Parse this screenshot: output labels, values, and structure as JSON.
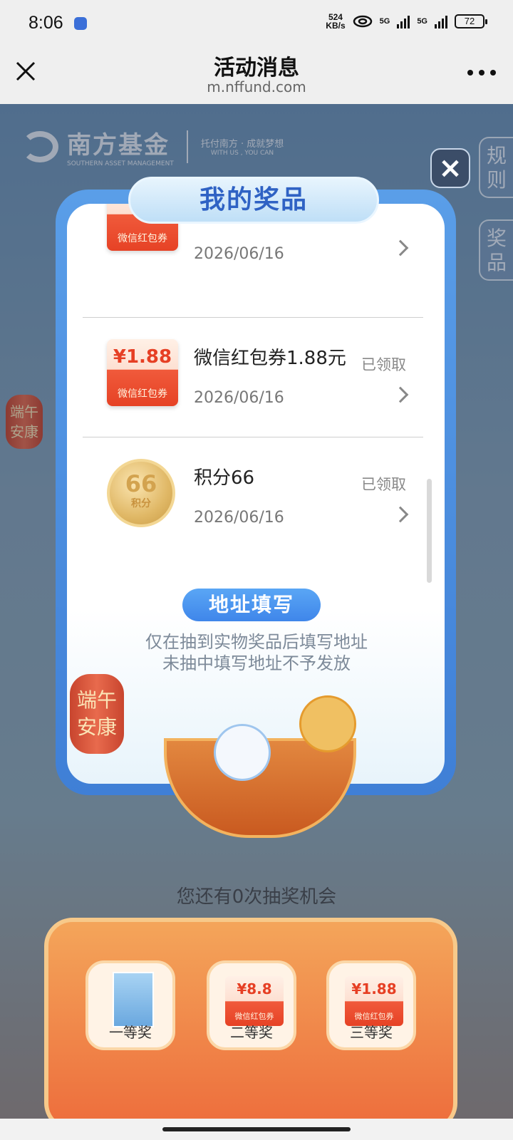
{
  "status": {
    "time": "8:06",
    "speed_num": "524",
    "speed_unit": "KB/s",
    "net1": "5G",
    "net2": "5G",
    "battery": "72"
  },
  "nav": {
    "title": "活动消息",
    "url": "m.nffund.com"
  },
  "bg": {
    "logo_name": "南方基金",
    "logo_sub": "SOUTHERN ASSET MANAGEMENT",
    "slogan": "托付南方 · 成就梦想",
    "slogan_en": "WITH US , YOU CAN",
    "tab_rules": "规则",
    "tab_prizes": "奖品",
    "lantern_text": "端午安康",
    "chance_text": "您还有0次抽奖机会"
  },
  "modal": {
    "title": "我的奖品",
    "close_icon": "close-icon",
    "prizes": [
      {
        "badge_label": "微信红包券",
        "title": "",
        "date": "2026/06/16",
        "status": ""
      },
      {
        "badge_amount": "¥1.88",
        "badge_label": "微信红包券",
        "title": "微信红包券1.88元",
        "date": "2026/06/16",
        "status": "已领取"
      },
      {
        "coin_num": "66",
        "coin_label": "积分",
        "title": "积分66",
        "date": "2026/06/16",
        "status": "已领取"
      }
    ],
    "address_button": "地址填写",
    "address_note_1": "仅在抽到实物奖品后填写地址",
    "address_note_2": "未抽中填写地址不予发放"
  },
  "board": {
    "cells": [
      {
        "label": "一等奖",
        "kind": "box"
      },
      {
        "label": "二等奖",
        "amount": "¥8.8",
        "pack_label": "微信红包券"
      },
      {
        "label": "三等奖",
        "amount": "¥1.88",
        "pack_label": "微信红包券"
      }
    ]
  },
  "colors": {
    "accent_blue": "#3f86ea",
    "red": "#e64225",
    "gold": "#e0b866"
  }
}
